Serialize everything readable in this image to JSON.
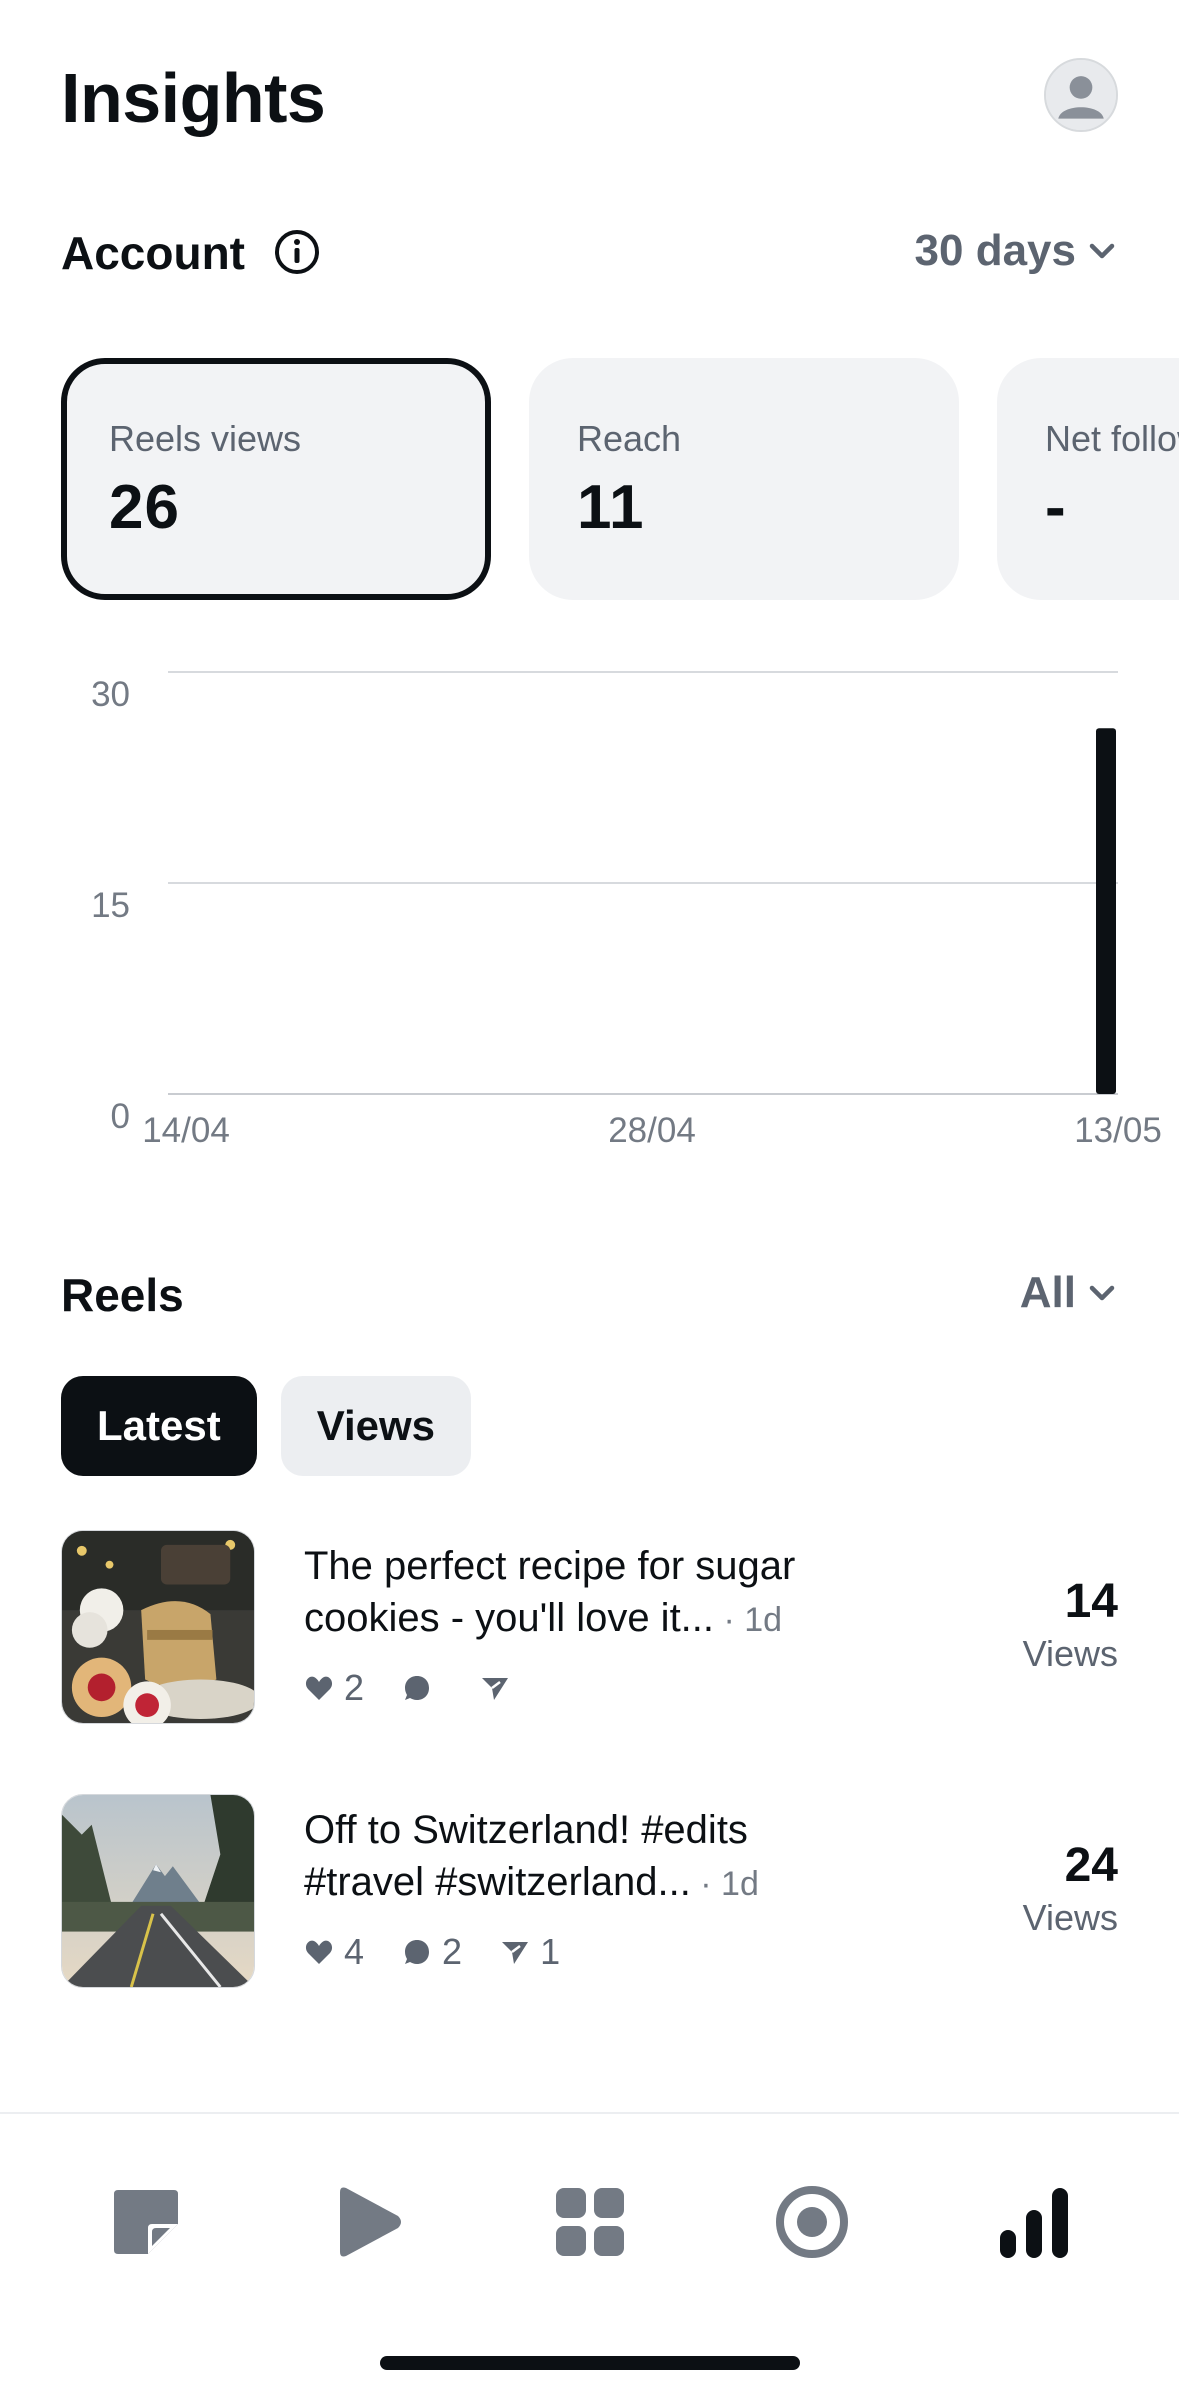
{
  "header": {
    "title": "Insights"
  },
  "account": {
    "title": "Account",
    "range": "30 days"
  },
  "cards": [
    {
      "label": "Reels views",
      "value": "26",
      "selected": true
    },
    {
      "label": "Reach",
      "value": "11",
      "selected": false
    },
    {
      "label": "Net follows",
      "value": "-",
      "selected": false
    }
  ],
  "chart_data": {
    "type": "bar",
    "x_ticks": [
      "14/04",
      "28/04",
      "13/05"
    ],
    "y_ticks": [
      "30",
      "15",
      "0"
    ],
    "ylim": [
      0,
      30
    ],
    "grid": true,
    "series": [
      {
        "x": "13/05",
        "value": 26
      }
    ],
    "bar_color": "#0c1014"
  },
  "reels": {
    "title": "Reels",
    "filter": "All",
    "tabs": [
      {
        "label": "Latest",
        "active": true
      },
      {
        "label": "Views",
        "active": false
      }
    ],
    "items": [
      {
        "title_line1": "The perfect recipe for sugar",
        "title_line2": "cookies - you'll love it...",
        "age": " · 1d",
        "likes": "2",
        "comments": "",
        "shares": "",
        "views": "14",
        "views_label": "Views"
      },
      {
        "title_line1": "Off to Switzerland! #edits",
        "title_line2": "#travel #switzerland...",
        "age": " · 1d",
        "likes": "4",
        "comments": "2",
        "shares": "1",
        "views": "24",
        "views_label": "Views"
      }
    ]
  },
  "tabbar": {
    "icons": [
      "posts-icon",
      "reels-icon",
      "apps-grid-icon",
      "record-icon",
      "insights-icon"
    ],
    "active": "insights-icon"
  },
  "colors": {
    "text": "#0c1014",
    "muted": "#5c6470",
    "card": "#f2f3f5",
    "accent": "#0c1014"
  }
}
